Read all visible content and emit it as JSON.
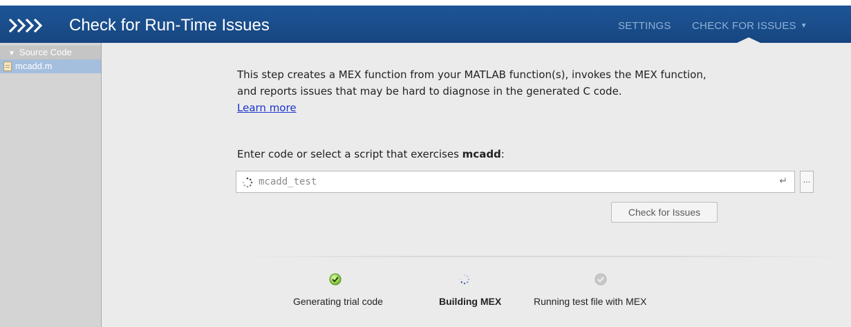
{
  "header": {
    "title": "Check for Run-Time Issues",
    "nav_settings": "SETTINGS",
    "nav_check": "CHECK FOR ISSUES",
    "colors": {
      "bar": "#1a4d8c",
      "nav_text": "#8fb0d8"
    }
  },
  "sidebar": {
    "section_label": "Source Code",
    "items": [
      {
        "label": "mcadd.m"
      }
    ]
  },
  "main": {
    "description": "This step creates a MEX function from your MATLAB function(s), invokes the MEX function, and reports issues that may be hard to diagnose in the generated C code.",
    "learn_more": "Learn more",
    "prompt_prefix": "Enter code or select a script that exercises ",
    "prompt_bold": "mcadd",
    "prompt_suffix": ":",
    "input_value": "mcadd_test",
    "browse_label": "...",
    "check_button": "Check for Issues"
  },
  "progress": {
    "steps": [
      {
        "label": "Generating trial code",
        "status": "done",
        "icon": "check-circle-icon"
      },
      {
        "label": "Building MEX",
        "status": "active",
        "icon": "spinner-icon"
      },
      {
        "label": "Running test file with MEX",
        "status": "pending",
        "icon": "check-circle-icon"
      }
    ]
  }
}
